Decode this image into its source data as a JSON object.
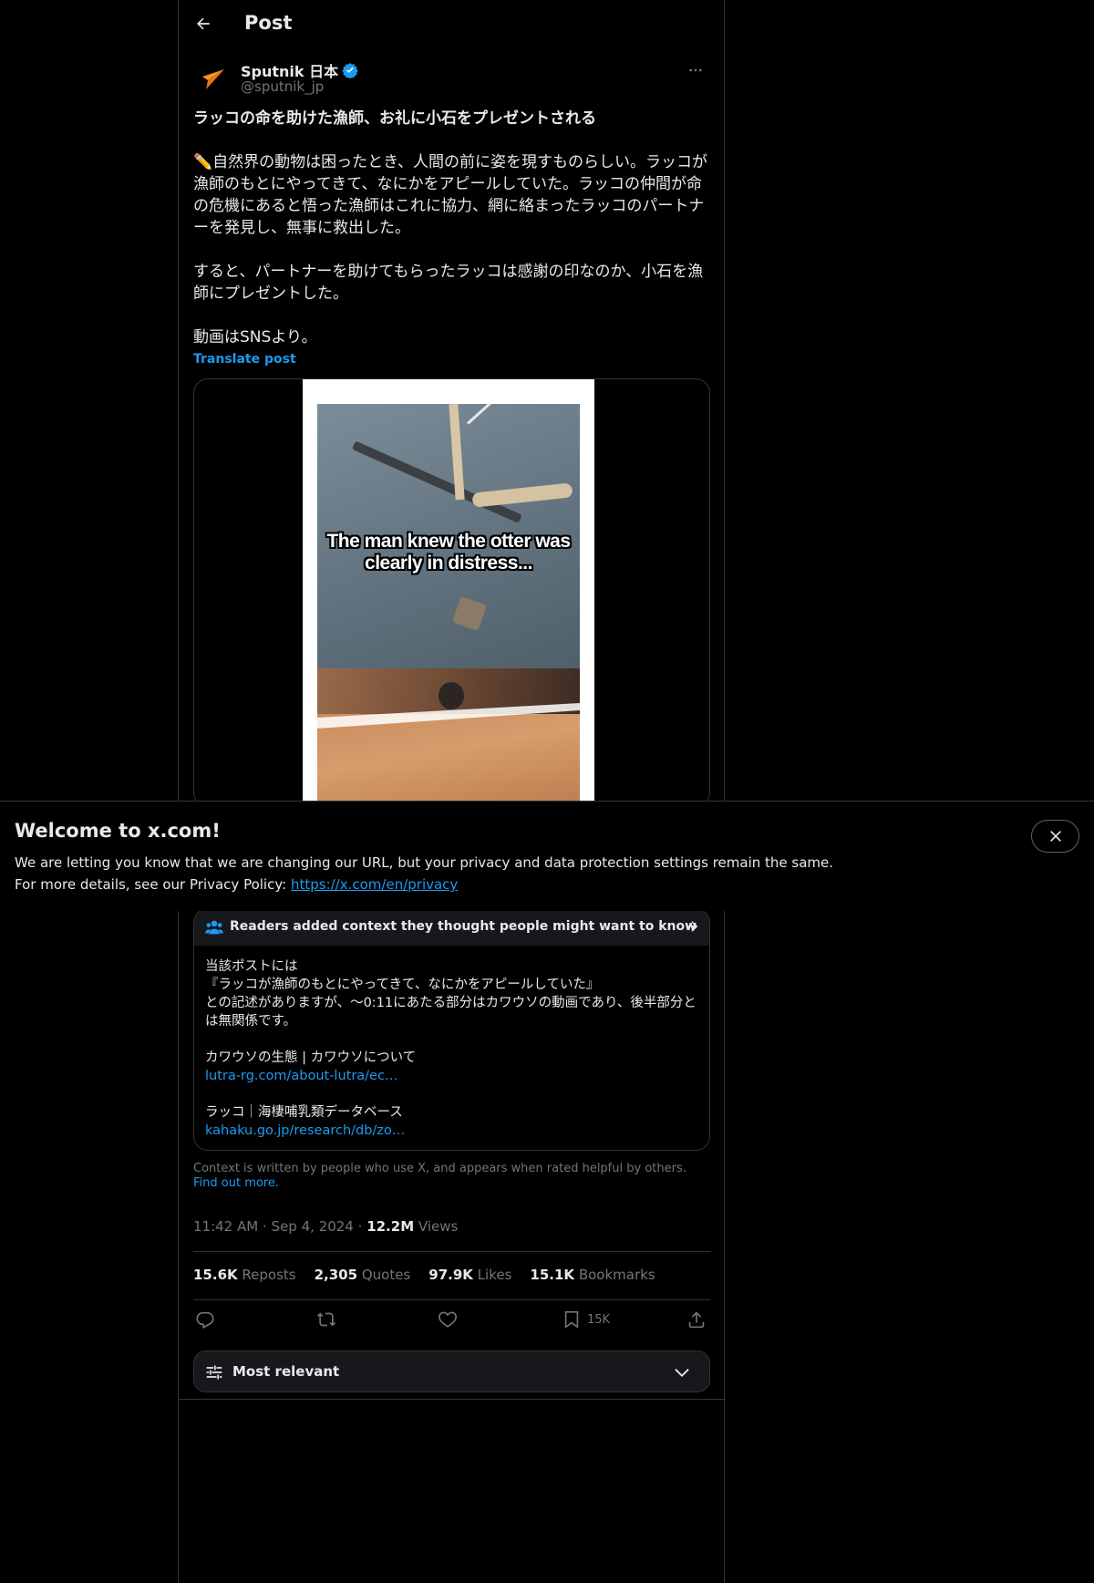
{
  "header": {
    "title": "Post"
  },
  "author": {
    "name": "Sputnik 日本",
    "handle": "@sputnik_jp"
  },
  "post": {
    "title": "ラッコの命を助けた漁師、お礼に小石をプレゼントされる",
    "paragraph1": "✏️自然界の動物は困ったとき、人間の前に姿を現すものらしい。ラッコが漁師のもとにやってきて、なにかをアピールしていた。ラッコの仲間が命の危機にあると悟った漁師はこれに協力、網に絡まったラッコのパートナーを発見し、無事に救出した。",
    "paragraph2": "すると、パートナーを助けてもらったラッコは感謝の印なのか、小石を漁師にプレゼントした。",
    "paragraph3": "動画はSNSより。",
    "translate_label": "Translate post"
  },
  "media": {
    "caption": "The man knew the otter was clearly in distress..."
  },
  "community_note": {
    "header": "Readers added context they thought people might want to know",
    "lines": [
      "当該ポストには",
      "『ラッコが漁師のもとにやってきて、なにかをアピールしていた』",
      "との記述がありますが、〜0:11にあたる部分はカワウソの動画であり、後半部分とは無関係です。"
    ],
    "ref1_title": "カワウソの生態 | カワウソについて",
    "ref1_link": "lutra-rg.com/about-lutra/ec…",
    "ref2_title": "ラッコ｜海棲哺乳類データベース",
    "ref2_link": "kahaku.go.jp/research/db/zo…",
    "footer_text": "Context is written by people who use X, and appears when rated helpful by others.",
    "footer_link": "Find out more."
  },
  "meta": {
    "time": "11:42 AM",
    "date": "Sep 4, 2024",
    "views_count": "12.2M",
    "views_label": "Views",
    "separator": "·"
  },
  "stats": {
    "reposts_count": "15.6K",
    "reposts_label": "Reposts",
    "quotes_count": "2,305",
    "quotes_label": "Quotes",
    "likes_count": "97.9K",
    "likes_label": "Likes",
    "bookmarks_count": "15.1K",
    "bookmarks_label": "Bookmarks"
  },
  "actions": {
    "bookmark_count": "15K"
  },
  "sort": {
    "label": "Most relevant"
  },
  "banner": {
    "title": "Welcome to x.com!",
    "line1": "We are letting you know that we are changing our URL, but your privacy and data protection settings remain the same.",
    "line2_prefix": "For more details, see our Privacy Policy:",
    "line2_link": "https://x.com/en/privacy"
  },
  "colors": {
    "accent": "#1d9bf0",
    "background": "#000000",
    "border": "#2f3336",
    "muted": "#71767b",
    "text": "#e7e9ea",
    "brand_orange": "#f7941d"
  }
}
